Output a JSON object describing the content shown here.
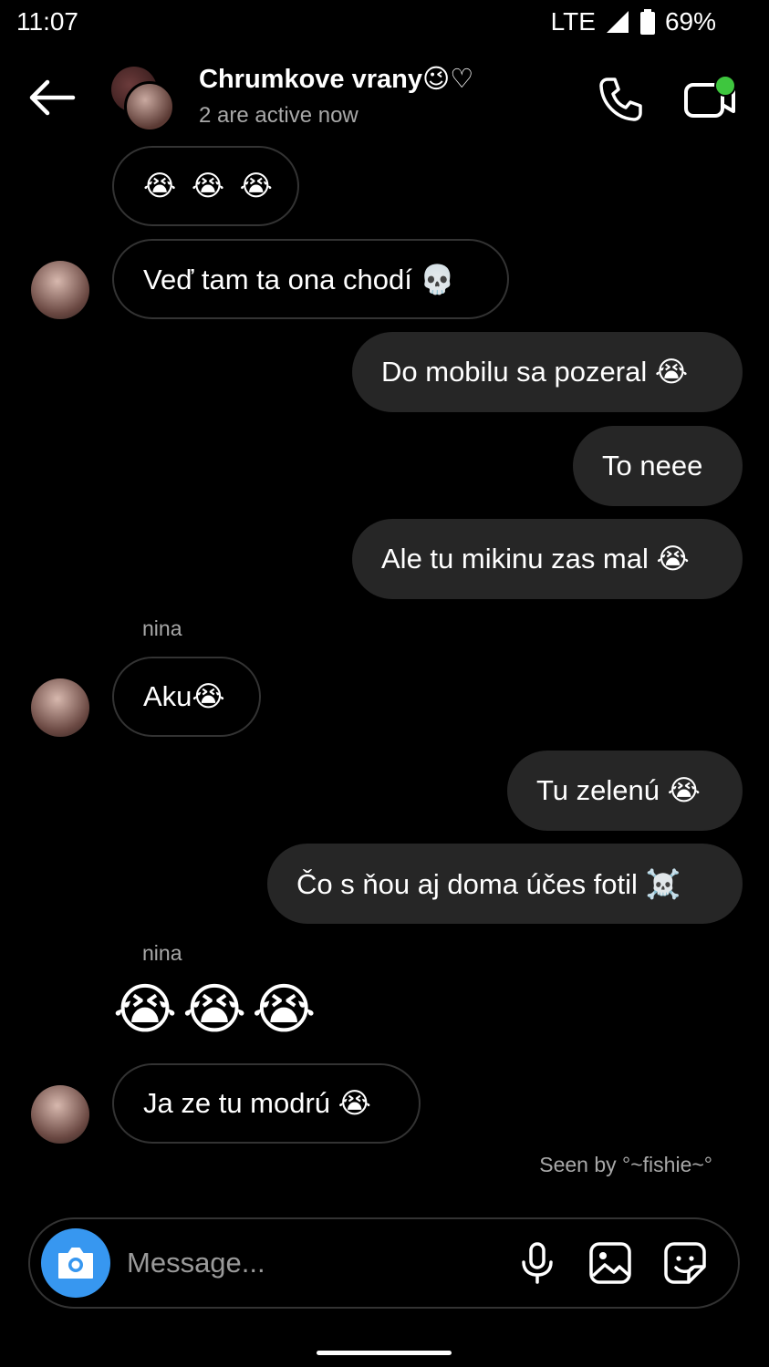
{
  "status_bar": {
    "time": "11:07",
    "network": "LTE",
    "battery": "69%"
  },
  "header": {
    "title": "Chrumkove vrany😉♡",
    "subtitle": "2 are active now"
  },
  "messages": [
    {
      "id": "m0",
      "text": "😭 😭 😭"
    },
    {
      "id": "m1",
      "text": "Veď tam ta ona chodí 💀"
    },
    {
      "id": "m2",
      "text": "Do mobilu sa pozeral 😭"
    },
    {
      "id": "m3",
      "text": "To neee"
    },
    {
      "id": "m4",
      "text": "Ale tu mikinu zas mal 😭"
    },
    {
      "id": "m5",
      "sender": "nina",
      "text": "Aku😭"
    },
    {
      "id": "m6",
      "text": "Tu zelenú 😭"
    },
    {
      "id": "m7",
      "text": "Čo s ňou aj doma účes fotil ☠️"
    },
    {
      "id": "m8",
      "sender": "nina",
      "text": "😭😭😭"
    },
    {
      "id": "m9",
      "text": "Ja ze tu modrú 😭"
    }
  ],
  "seen_by": "Seen by °~fishie~°",
  "composer": {
    "placeholder": "Message..."
  },
  "icons": {
    "back": "arrow-left-icon",
    "call": "phone-icon",
    "video": "video-icon",
    "camera": "camera-icon",
    "mic": "microphone-icon",
    "gallery": "image-icon",
    "sticker": "sticker-icon"
  },
  "colors": {
    "background": "#000000",
    "outgoing_bubble": "#262626",
    "camera_button": "#3797f0",
    "active_dot": "#3ec63e"
  }
}
